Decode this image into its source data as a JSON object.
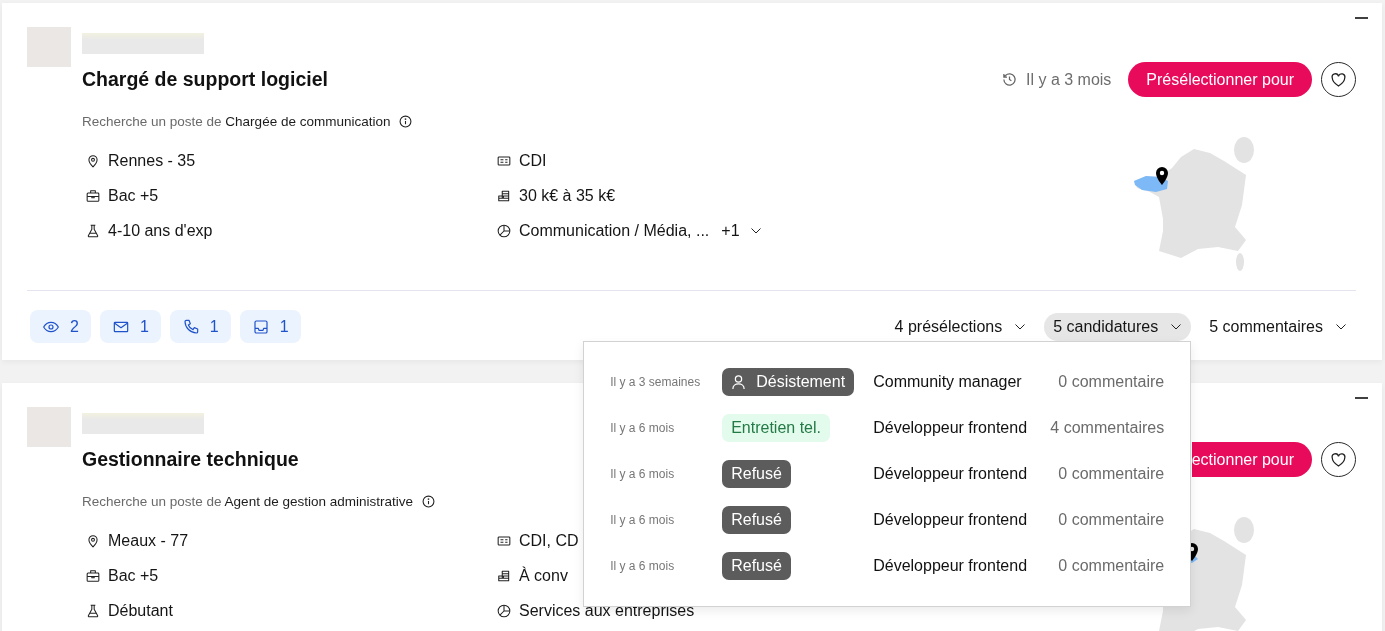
{
  "cards": [
    {
      "title": "Chargé de support logiciel",
      "posted": "Il y a 3 mois",
      "action": {
        "label": "Présélectionner pour",
        "cut_off": false
      },
      "favorite": false,
      "search": {
        "prefix": "Recherche un poste de",
        "role": "Chargée de communication"
      },
      "details": [
        {
          "kind": "location",
          "text": "Rennes - 35"
        },
        {
          "kind": "contract",
          "text": "CDI"
        },
        {
          "kind": "education",
          "text": "Bac +5"
        },
        {
          "kind": "salary",
          "text": "30 k€ à 35 k€"
        },
        {
          "kind": "experience",
          "text": "4-10 ans d'exp"
        },
        {
          "kind": "sector",
          "text": "Communication / Média, ...",
          "more": "+1"
        }
      ],
      "stats": [
        {
          "kind": "views",
          "count": "2"
        },
        {
          "kind": "emails",
          "count": "1"
        },
        {
          "kind": "calls",
          "count": "1"
        },
        {
          "kind": "inbox",
          "count": "1"
        }
      ],
      "toggles": [
        {
          "label": "4 présélections",
          "expanded": false
        },
        {
          "label": "5 candidatures",
          "expanded": true,
          "items": [
            {
              "date": "Il y a 3 semaines",
              "status": {
                "kind": "withdrawn",
                "label": "Désistement"
              },
              "role": "Community manager",
              "comments": "0 commentaire"
            },
            {
              "date": "Il y a 6 mois",
              "status": {
                "kind": "interview",
                "label": "Entretien tel."
              },
              "role": "Développeur frontend",
              "comments": "4 commentaires"
            },
            {
              "date": "Il y a 6 mois",
              "status": {
                "kind": "rejected",
                "label": "Refusé"
              },
              "role": "Développeur frontend",
              "comments": "0 commentaire"
            },
            {
              "date": "Il y a 6 mois",
              "status": {
                "kind": "rejected",
                "label": "Refusé"
              },
              "role": "Développeur frontend",
              "comments": "0 commentaire"
            },
            {
              "date": "Il y a 6 mois",
              "status": {
                "kind": "rejected",
                "label": "Refusé"
              },
              "role": "Développeur frontend",
              "comments": "0 commentaire"
            }
          ]
        },
        {
          "label": "5 commentaires",
          "expanded": false
        }
      ]
    },
    {
      "title": "Gestionnaire technique",
      "action": {
        "label": "ectionner pour",
        "cut_off": true
      },
      "favorite": false,
      "search": {
        "prefix": "Recherche un poste de",
        "role": "Agent de gestion administrative"
      },
      "details": [
        {
          "kind": "location",
          "text": "Meaux - 77"
        },
        {
          "kind": "contract",
          "text": "CDI, CD"
        },
        {
          "kind": "education",
          "text": "Bac +5"
        },
        {
          "kind": "salary",
          "text": "À conv"
        },
        {
          "kind": "experience",
          "text": "Débutant"
        },
        {
          "kind": "sector",
          "text": "Services aux entreprises"
        }
      ]
    }
  ]
}
